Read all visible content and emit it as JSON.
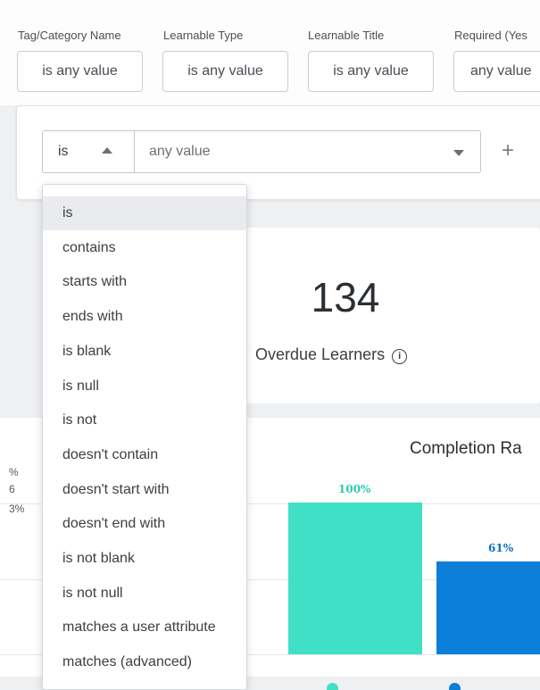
{
  "filters": [
    {
      "label": "Tag/Category Name",
      "value": "is any value"
    },
    {
      "label": "Learnable Type",
      "value": "is any value"
    },
    {
      "label": "Learnable Title",
      "value": "is any value"
    },
    {
      "label": "Required (Yes",
      "value": "any value"
    }
  ],
  "editor": {
    "operator": "is",
    "value_placeholder": "any value",
    "add_label": "+"
  },
  "operator_menu": {
    "selected": "is",
    "items": [
      "is",
      "contains",
      "starts with",
      "ends with",
      "is blank",
      "is null",
      "is not",
      "doesn't contain",
      "doesn't start with",
      "doesn't end with",
      "is not blank",
      "is not null",
      "matches a user attribute",
      "matches (advanced)"
    ]
  },
  "kpi": {
    "value": "134",
    "label": "Overdue Learners",
    "info_icon": "info-icon"
  },
  "chart": {
    "title": "Completion Ra",
    "axis_fragments": [
      "%",
      "6",
      "3%"
    ]
  },
  "chart_data": {
    "type": "bar",
    "title": "Completion Ra",
    "categories": [
      "",
      ""
    ],
    "values": [
      100,
      61
    ],
    "data_labels": [
      "100%",
      "61%"
    ],
    "colors": [
      "#3fe0c5",
      "#0a7ed8"
    ],
    "ylim": [
      0,
      100
    ]
  },
  "colors": {
    "bar_teal": "#3fe0c5",
    "bar_blue": "#0a7ed8",
    "label_teal": "#2fc9ae",
    "label_blue": "#0a6fc2",
    "menu_selected": "#e9ebee"
  }
}
